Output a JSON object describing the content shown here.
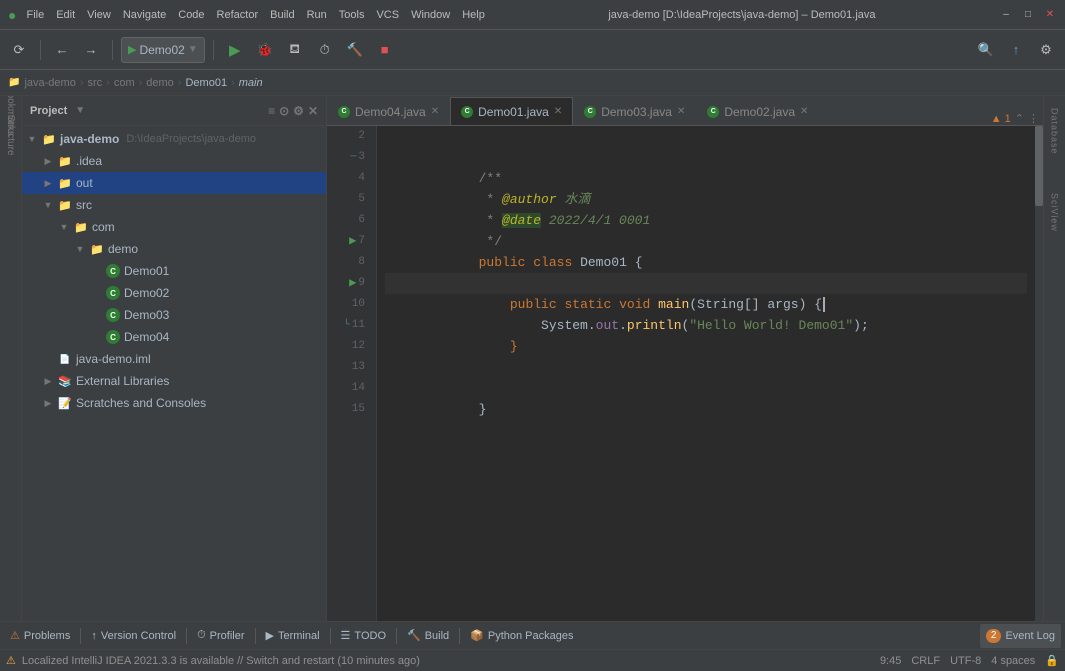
{
  "titleBar": {
    "menuItems": [
      "File",
      "Edit",
      "View",
      "Navigate",
      "Code",
      "Refactor",
      "Build",
      "Run",
      "Tools",
      "VCS",
      "Window",
      "Help"
    ],
    "title": "java-demo [D:\\IdeaProjects\\java-demo] – Demo01.java",
    "winButtons": [
      "–",
      "□",
      "✕"
    ]
  },
  "toolbar": {
    "runConfig": "Demo02",
    "buttons": [
      "sync",
      "navigate-back",
      "navigate-forward",
      "run",
      "debug",
      "coverage",
      "profile",
      "build",
      "stop",
      "search",
      "update",
      "settings"
    ]
  },
  "breadcrumb": {
    "items": [
      "java-demo",
      "src",
      "com",
      "demo",
      "Demo01",
      "main"
    ]
  },
  "sidebar": {
    "title": "Project",
    "root": "java-demo",
    "rootPath": "D:\\IdeaProjects\\java-demo",
    "tree": [
      {
        "id": "java-demo",
        "label": "java-demo",
        "path": "D:\\IdeaProjects\\java-demo",
        "type": "root",
        "open": true,
        "indent": 0
      },
      {
        "id": "idea",
        "label": ".idea",
        "type": "folder",
        "open": false,
        "indent": 1
      },
      {
        "id": "out",
        "label": "out",
        "type": "folder",
        "open": false,
        "indent": 1,
        "selected": true
      },
      {
        "id": "src",
        "label": "src",
        "type": "folder",
        "open": true,
        "indent": 1
      },
      {
        "id": "com",
        "label": "com",
        "type": "folder",
        "open": true,
        "indent": 2
      },
      {
        "id": "demo",
        "label": "demo",
        "type": "folder",
        "open": true,
        "indent": 3
      },
      {
        "id": "Demo01",
        "label": "Demo01",
        "type": "java",
        "indent": 4
      },
      {
        "id": "Demo02",
        "label": "Demo02",
        "type": "java",
        "indent": 4
      },
      {
        "id": "Demo03",
        "label": "Demo03",
        "type": "java",
        "indent": 4
      },
      {
        "id": "Demo04",
        "label": "Demo04",
        "type": "java",
        "indent": 4
      },
      {
        "id": "java-demo.iml",
        "label": "java-demo.iml",
        "type": "iml",
        "indent": 1
      },
      {
        "id": "external-libs",
        "label": "External Libraries",
        "type": "lib",
        "open": false,
        "indent": 1
      },
      {
        "id": "scratches",
        "label": "Scratches and Consoles",
        "type": "scratch",
        "open": false,
        "indent": 1
      }
    ]
  },
  "tabs": [
    {
      "id": "Demo04",
      "label": "Demo04.java",
      "active": false,
      "modified": false
    },
    {
      "id": "Demo01",
      "label": "Demo01.java",
      "active": true,
      "modified": false
    },
    {
      "id": "Demo03",
      "label": "Demo03.java",
      "active": false,
      "modified": false
    },
    {
      "id": "Demo02",
      "label": "Demo02.java",
      "active": false,
      "modified": false
    }
  ],
  "editor": {
    "lines": [
      {
        "num": 2,
        "content": "",
        "type": "blank"
      },
      {
        "num": 3,
        "content": "/**",
        "type": "comment-start"
      },
      {
        "num": 4,
        "content": " * @author 水滴",
        "type": "comment-tag"
      },
      {
        "num": 5,
        "content": " * @date 2022/4/1 0001",
        "type": "comment-tag-date"
      },
      {
        "num": 6,
        "content": " */",
        "type": "comment-end"
      },
      {
        "num": 7,
        "content": "public class Demo01 {",
        "type": "class-decl"
      },
      {
        "num": 8,
        "content": "",
        "type": "blank"
      },
      {
        "num": 9,
        "content": "    public static void main(String[] args) {",
        "type": "method-decl"
      },
      {
        "num": 10,
        "content": "        System.out.println(\"Hello World! Demo01\");",
        "type": "method-body"
      },
      {
        "num": 11,
        "content": "    }",
        "type": "close-brace"
      },
      {
        "num": 12,
        "content": "",
        "type": "blank"
      },
      {
        "num": 13,
        "content": "",
        "type": "blank"
      },
      {
        "num": 14,
        "content": "}",
        "type": "close-class"
      },
      {
        "num": 15,
        "content": "",
        "type": "blank"
      }
    ]
  },
  "statusBar": {
    "leftMessage": "Localized IntelliJ IDEA 2021.3.3 is available // Switch and restart (10 minutes ago)",
    "time": "9:45",
    "encoding": "CRLF",
    "charset": "UTF-8",
    "indent": "4 spaces",
    "warningIcon": "⚠"
  },
  "bottomToolbar": {
    "items": [
      {
        "id": "problems",
        "label": "Problems",
        "icon": "⚠"
      },
      {
        "id": "version-control",
        "label": "Version Control",
        "icon": "↑"
      },
      {
        "id": "profiler",
        "label": "Profiler",
        "icon": "⏱"
      },
      {
        "id": "terminal",
        "label": "Terminal",
        "icon": "▶"
      },
      {
        "id": "todo",
        "label": "TODO",
        "icon": "☰"
      },
      {
        "id": "build",
        "label": "Build",
        "icon": "🔨"
      },
      {
        "id": "python-packages",
        "label": "Python Packages",
        "icon": "📦"
      }
    ],
    "eventLog": {
      "label": "Event Log",
      "count": "2"
    }
  },
  "rightPanel": {
    "labels": [
      "Database",
      "SciView"
    ]
  },
  "warnings": {
    "count": "1",
    "icon": "▲"
  }
}
